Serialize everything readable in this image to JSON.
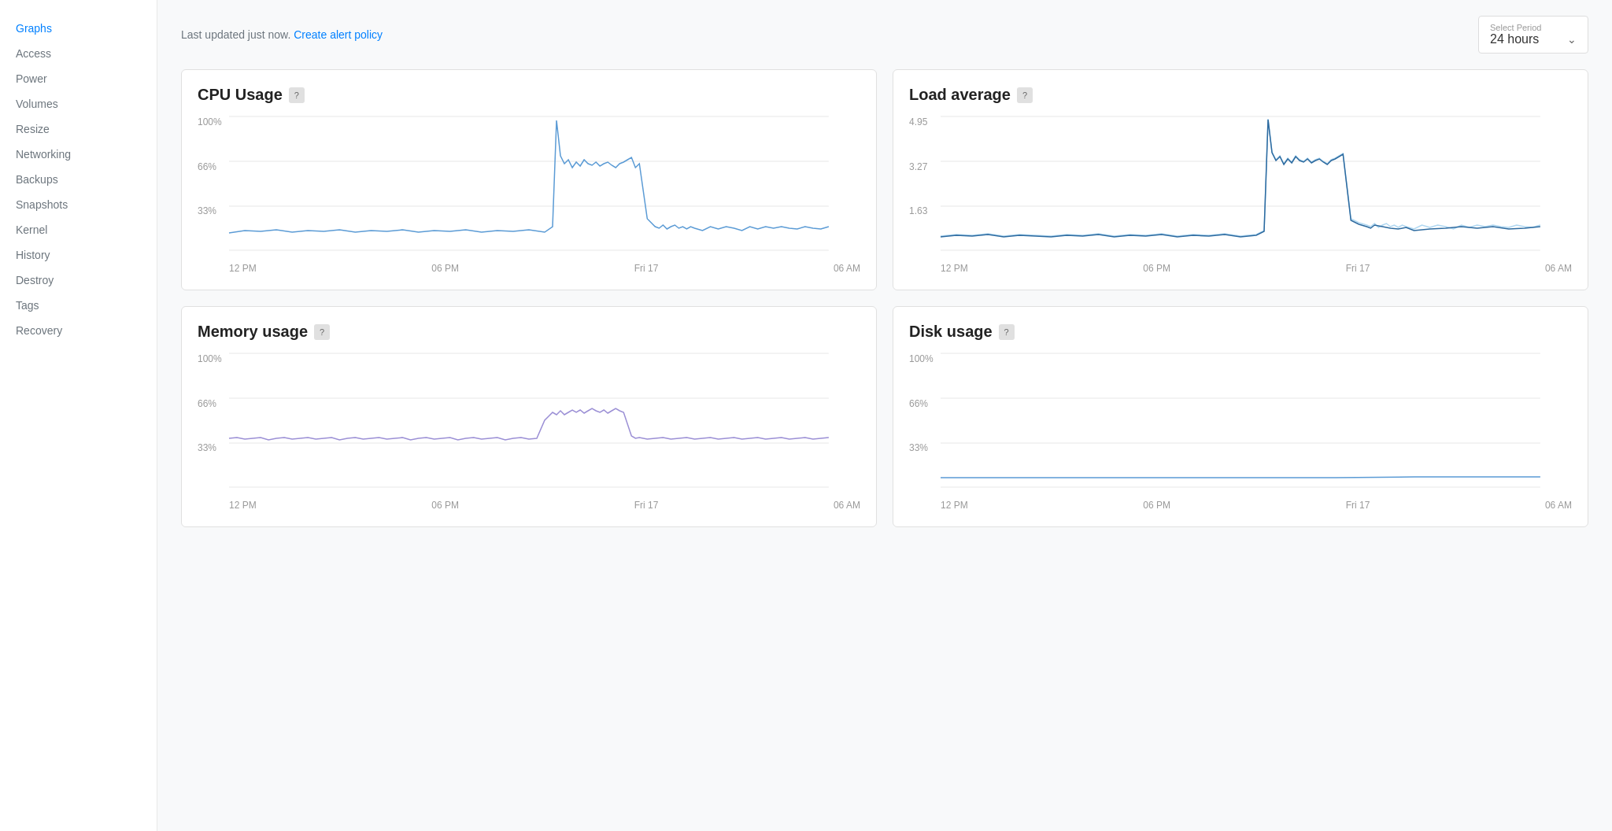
{
  "sidebar": {
    "items": [
      {
        "label": "Graphs",
        "active": true,
        "id": "graphs"
      },
      {
        "label": "Access",
        "active": false,
        "id": "access"
      },
      {
        "label": "Power",
        "active": false,
        "id": "power"
      },
      {
        "label": "Volumes",
        "active": false,
        "id": "volumes"
      },
      {
        "label": "Resize",
        "active": false,
        "id": "resize"
      },
      {
        "label": "Networking",
        "active": false,
        "id": "networking"
      },
      {
        "label": "Backups",
        "active": false,
        "id": "backups"
      },
      {
        "label": "Snapshots",
        "active": false,
        "id": "snapshots"
      },
      {
        "label": "Kernel",
        "active": false,
        "id": "kernel"
      },
      {
        "label": "History",
        "active": false,
        "id": "history"
      },
      {
        "label": "Destroy",
        "active": false,
        "id": "destroy"
      },
      {
        "label": "Tags",
        "active": false,
        "id": "tags"
      },
      {
        "label": "Recovery",
        "active": false,
        "id": "recovery"
      }
    ]
  },
  "header": {
    "last_updated": "Last updated just now.",
    "create_alert_link": "Create alert policy"
  },
  "period_selector": {
    "label": "Select Period",
    "value": "24 hours"
  },
  "charts": [
    {
      "id": "cpu-usage",
      "title": "CPU Usage",
      "y_labels": [
        "100%",
        "66%",
        "33%"
      ],
      "x_labels": [
        "12 PM",
        "06 PM",
        "Fri 17",
        "06 AM"
      ],
      "type": "percentage",
      "color": "#5b9bd5",
      "color2": null
    },
    {
      "id": "load-average",
      "title": "Load average",
      "y_labels": [
        "4.95",
        "3.27",
        "1.63"
      ],
      "x_labels": [
        "12 PM",
        "06 PM",
        "Fri 17",
        "06 AM"
      ],
      "type": "value",
      "color": "#5b9bd5",
      "color2": "#2d6a9f"
    },
    {
      "id": "memory-usage",
      "title": "Memory usage",
      "y_labels": [
        "100%",
        "66%",
        "33%"
      ],
      "x_labels": [
        "12 PM",
        "06 PM",
        "Fri 17",
        "06 AM"
      ],
      "type": "percentage",
      "color": "#9b8fd5",
      "color2": null
    },
    {
      "id": "disk-usage",
      "title": "Disk usage",
      "y_labels": [
        "100%",
        "66%",
        "33%"
      ],
      "x_labels": [
        "12 PM",
        "06 PM",
        "Fri 17",
        "06 AM"
      ],
      "type": "percentage",
      "color": "#5b9bd5",
      "color2": null
    }
  ]
}
